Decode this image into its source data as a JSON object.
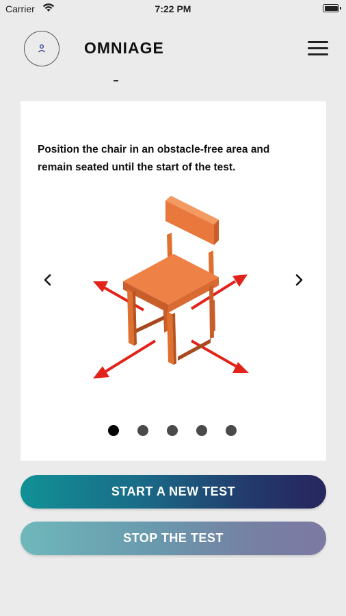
{
  "status_bar": {
    "carrier": "Carrier",
    "time": "7:22 PM"
  },
  "header": {
    "title": "OMNIAGE",
    "avatar_icon": "person-icon",
    "menu_icon": "hamburger-menu-icon"
  },
  "card": {
    "instruction_line1": "Position the chair in an obstacle-free area and",
    "instruction_line2": "remain seated until the start of the test.",
    "illustration": "chair-with-clearance-arrows",
    "carousel": {
      "total": 5,
      "active": 1
    }
  },
  "buttons": {
    "start": "START A NEW TEST",
    "stop": "STOP THE TEST"
  },
  "colors": {
    "chair": "#e8783c",
    "arrow": "#e2231a",
    "accent_start": "#119195",
    "accent_end": "#27255e"
  }
}
